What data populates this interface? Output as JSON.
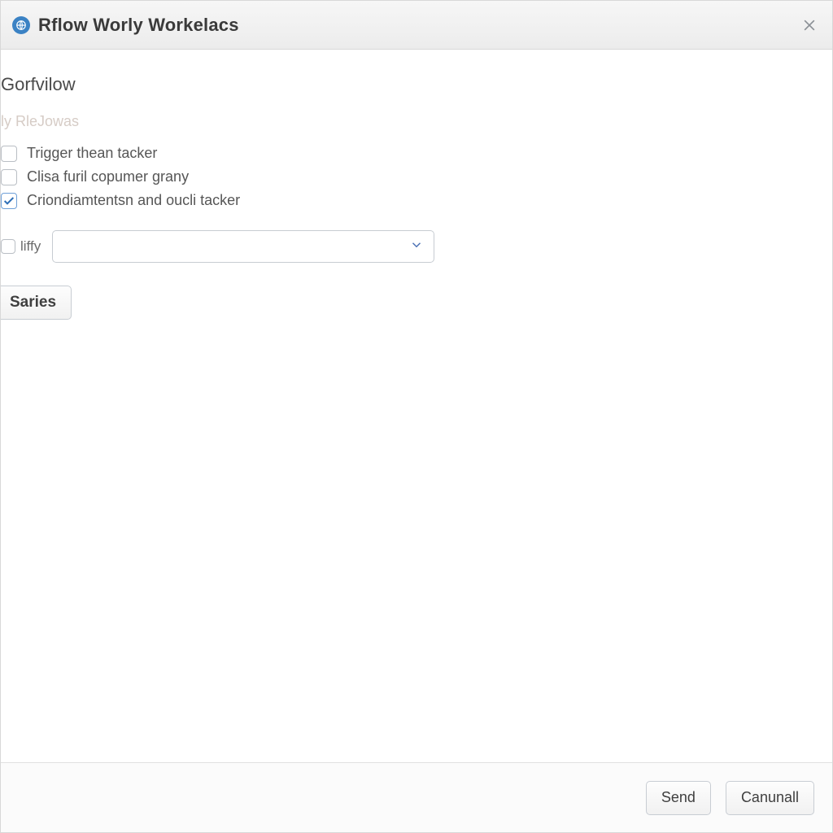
{
  "header": {
    "title": "Rflow Worly Workelacs"
  },
  "section": {
    "title": "Gorfvilow",
    "faint_hint": "ly RleJowas"
  },
  "options": [
    {
      "label": "Trigger thean tacker",
      "checked": false
    },
    {
      "label": "Clisa furil copumer grany",
      "checked": false
    },
    {
      "label": "Criondiamtentsn and oucli tacker",
      "checked": true
    }
  ],
  "select_row": {
    "mini_label": "liffy",
    "selected_value": ""
  },
  "buttons": {
    "garies": "Saries",
    "send": "Send",
    "cancel": "Canunall"
  }
}
